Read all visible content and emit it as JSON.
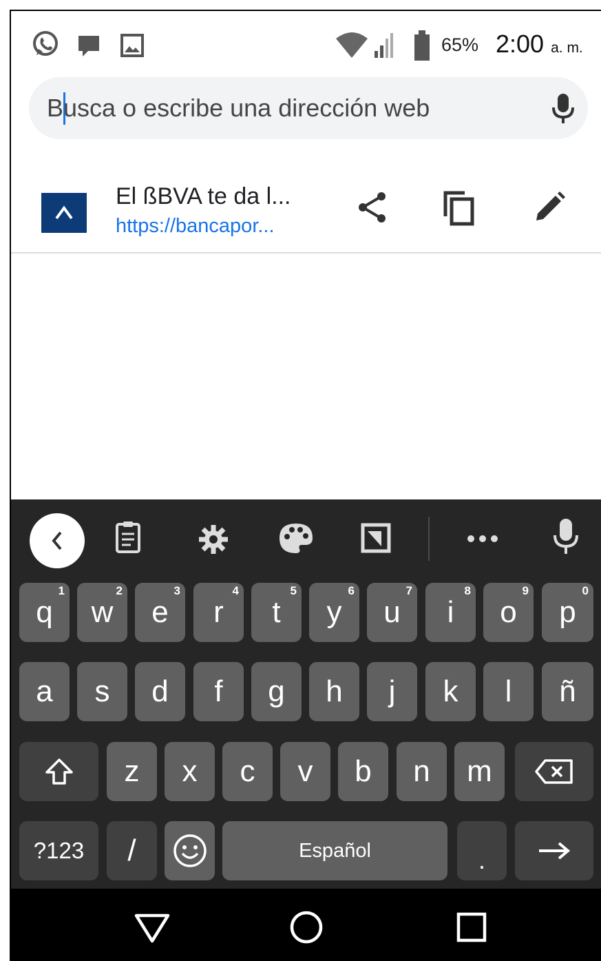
{
  "status_bar": {
    "battery_percent": "65%",
    "time": "2:00",
    "ampm": "a. m.",
    "icons": [
      "whatsapp-icon",
      "message-icon",
      "image-icon",
      "wifi-icon",
      "signal-icon",
      "battery-icon"
    ]
  },
  "omnibox": {
    "placeholder": "Busca o escribe una dirección web"
  },
  "suggestion": {
    "title": "El ßBVA te da l...",
    "url": "https://bancapor..."
  },
  "keyboard": {
    "row1": [
      {
        "k": "q",
        "h": "1"
      },
      {
        "k": "w",
        "h": "2"
      },
      {
        "k": "e",
        "h": "3"
      },
      {
        "k": "r",
        "h": "4"
      },
      {
        "k": "t",
        "h": "5"
      },
      {
        "k": "y",
        "h": "6"
      },
      {
        "k": "u",
        "h": "7"
      },
      {
        "k": "i",
        "h": "8"
      },
      {
        "k": "o",
        "h": "9"
      },
      {
        "k": "p",
        "h": "0"
      }
    ],
    "row2": [
      "a",
      "s",
      "d",
      "f",
      "g",
      "h",
      "j",
      "k",
      "l",
      "ñ"
    ],
    "row3": [
      "z",
      "x",
      "c",
      "v",
      "b",
      "n",
      "m"
    ],
    "symbols_label": "?123",
    "slash_label": "/",
    "space_label": "Español",
    "period_label": "."
  },
  "colors": {
    "accent": "#1a73e8",
    "keyboard_bg": "#262626",
    "key_bg": "#606060",
    "key_dark_bg": "#404040",
    "favicon_bg": "#0d3b78"
  }
}
